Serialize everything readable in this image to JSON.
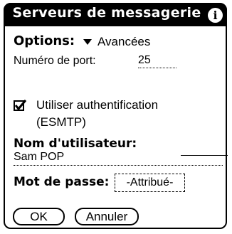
{
  "title": "Serveurs de messagerie",
  "icons": {
    "info": "info-icon",
    "dropdown": "triangle-down-icon",
    "checkbox": "checkbox-checked-icon"
  },
  "options": {
    "label": "Options:",
    "value": "Avancées"
  },
  "port": {
    "label": "Numéro de port:",
    "value": "25"
  },
  "auth": {
    "checked": true,
    "line1": "Utiliser authentification",
    "line2": "(ESMTP)"
  },
  "username": {
    "label": "Nom d'utilisateur:",
    "value": "Sam POP"
  },
  "password": {
    "label": "Mot de passe:",
    "value": "-Attribué-"
  },
  "buttons": {
    "ok": "OK",
    "cancel": "Annuler"
  }
}
